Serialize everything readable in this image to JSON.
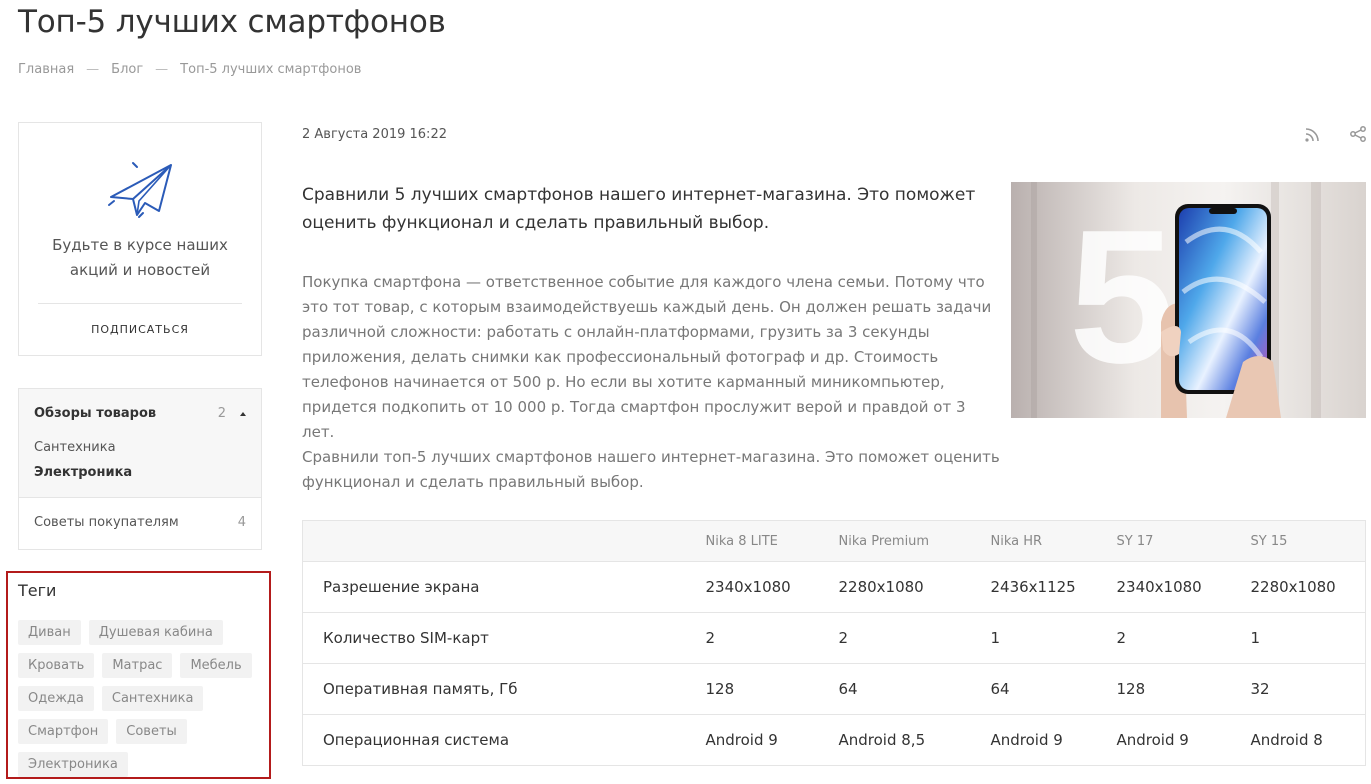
{
  "page": {
    "title": "Топ-5 лучших смартфонов"
  },
  "breadcrumb": {
    "home": "Главная",
    "blog": "Блог",
    "current": "Топ-5 лучших смартфонов",
    "separator": "—"
  },
  "subscribe": {
    "text": "Будьте в курсе наших акций и новостей",
    "button": "ПОДПИСАТЬСЯ"
  },
  "categories": {
    "groups": [
      {
        "title": "Обзоры товаров",
        "count": "2",
        "children": [
          "Сантехника",
          "Электроника"
        ]
      },
      {
        "title": "Советы покупателям",
        "count": "4"
      }
    ]
  },
  "tags": {
    "title": "Теги",
    "items": [
      "Диван",
      "Душевая кабина",
      "Кровать",
      "Матрас",
      "Мебель",
      "Одежда",
      "Сантехника",
      "Смартфон",
      "Советы",
      "Электроника"
    ]
  },
  "article": {
    "date": "2 Августа 2019 16:22",
    "lead": "Сравнили 5 лучших смартфонов нашего интернет-магазина. Это поможет оценить функционал и сделать правильный выбор.",
    "paragraph1": "Покупка смартфона — ответственное событие для каждого члена семьи. Потому что это тот товар, с которым взаимодействуешь каждый день. Он должен решать задачи различной сложности: работать с онлайн-платформами, грузить за 3 секунды приложения, делать снимки как профессиональный фотограф и др. Стоимость телефонов начинается от 500 р. Но если вы хотите карманный миникомпьютер, придется подкопить от 10 000 р. Тогда смартфон прослужит верой и правдой от 3 лет.",
    "paragraph2": "Сравнили топ-5 лучших смартфонов нашего интернет-магазина. Это поможет оценить функционал и сделать правильный выбор.",
    "image_big_number": "5"
  },
  "table": {
    "headers": [
      "",
      "Nika 8 LITE",
      "Nika Premium",
      "Nika HR",
      "SY 17",
      "SY 15"
    ],
    "rows": [
      [
        "Разрешение экрана",
        "2340x1080",
        "2280x1080",
        "2436x1125",
        "2340x1080",
        "2280x1080"
      ],
      [
        "Количество SIM-карт",
        "2",
        "2",
        "1",
        "2",
        "1"
      ],
      [
        "Оперативная память, Гб",
        "128",
        "64",
        "64",
        "128",
        "32"
      ],
      [
        "Операционная система",
        "Android 9",
        "Android 8,5",
        "Android 9",
        "Android 9",
        "Android 8"
      ]
    ]
  },
  "icons": {
    "rss": "rss-icon",
    "share": "share-icon",
    "plane": "paper-plane-icon"
  },
  "colors": {
    "accent": "#2b5bb8",
    "highlight_border": "#b31b1b"
  }
}
